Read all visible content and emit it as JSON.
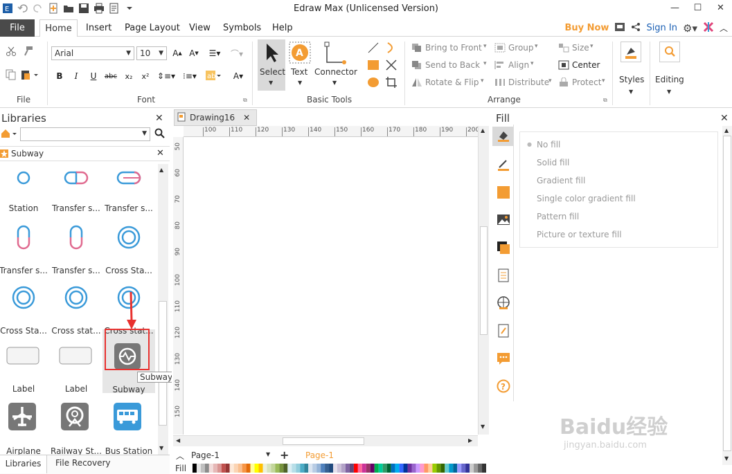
{
  "app": {
    "title": "Edraw Max (Unlicensed Version)"
  },
  "menu": {
    "file": "File",
    "home": "Home",
    "insert": "Insert",
    "page_layout": "Page Layout",
    "view": "View",
    "symbols": "Symbols",
    "help": "Help",
    "buy_now": "Buy Now",
    "sign_in": "Sign In"
  },
  "ribbon": {
    "font": {
      "name": "Arial",
      "size": "10",
      "group_label": "Font"
    },
    "file_group_label": "File",
    "basic_tools": {
      "select": "Select",
      "text": "Text",
      "connector": "Connector",
      "group_label": "Basic Tools"
    },
    "arrange": {
      "bring_to_front": "Bring to Front",
      "send_to_back": "Send to Back",
      "rotate_flip": "Rotate & Flip",
      "group": "Group",
      "align": "Align",
      "distribute": "Distribute",
      "size": "Size",
      "center": "Center",
      "protect": "Protect",
      "group_label": "Arrange"
    },
    "styles": "Styles",
    "editing": "Editing"
  },
  "libraries": {
    "title": "Libraries",
    "section": "Subway",
    "items": [
      {
        "label": "Station"
      },
      {
        "label": "Transfer s..."
      },
      {
        "label": "Transfer s..."
      },
      {
        "label": "Transfer s..."
      },
      {
        "label": "Transfer s..."
      },
      {
        "label": "Cross Sta..."
      },
      {
        "label": "Cross Sta..."
      },
      {
        "label": "Cross stat..."
      },
      {
        "label": "Cross stat..."
      },
      {
        "label": "Label"
      },
      {
        "label": "Label"
      },
      {
        "label": "Subway"
      },
      {
        "label": "Airplane"
      },
      {
        "label": "Railway St..."
      },
      {
        "label": "Bus Station"
      }
    ],
    "tooltip": "Subway",
    "bottom_tabs": [
      "Libraries",
      "File Recovery"
    ]
  },
  "document": {
    "tab": "Drawing16",
    "page_selector": "Page-1",
    "page_tab": "Page-1",
    "fill_label": "Fill"
  },
  "ruler": {
    "h": [
      "100",
      "110",
      "120",
      "130",
      "140",
      "150",
      "160",
      "170",
      "180",
      "190",
      "200"
    ],
    "v": [
      "50",
      "60",
      "70",
      "80",
      "90",
      "100",
      "110",
      "120",
      "130",
      "140",
      "150"
    ]
  },
  "fill_panel": {
    "title": "Fill",
    "options": [
      "No fill",
      "Solid fill",
      "Gradient fill",
      "Single color gradient fill",
      "Pattern fill",
      "Picture or texture fill"
    ]
  },
  "colors": {
    "accent": "#f39c33",
    "file_tab": "#4a4a4a",
    "line_blue": "#3a9ad9",
    "pink": "#e06a8f",
    "highlight": "#e8312f"
  },
  "watermark": {
    "text1": "Baidu经验",
    "text2": "jingyan.baidu.com"
  }
}
